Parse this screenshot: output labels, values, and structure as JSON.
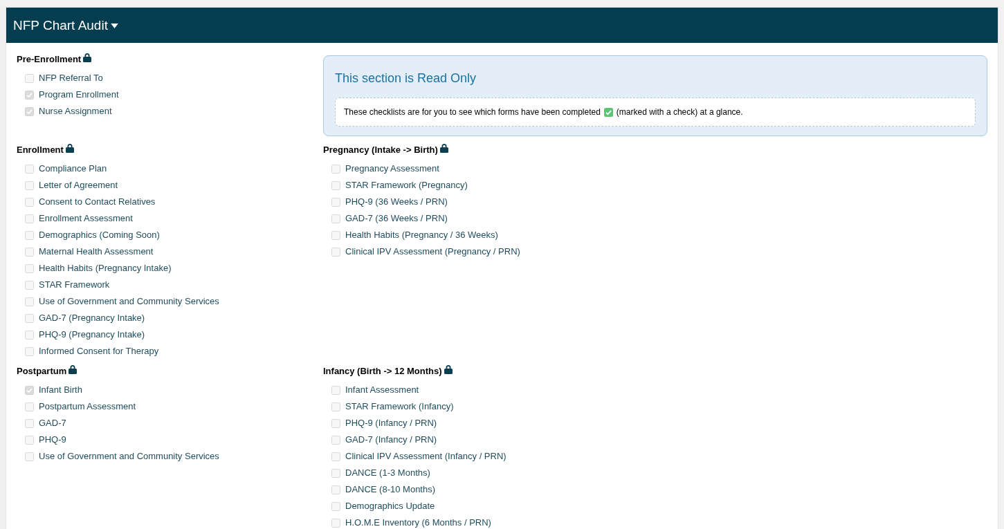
{
  "header": {
    "title": "NFP Chart Audit"
  },
  "notice": {
    "title": "This section is Read Only",
    "text_before": "These checklists are for you to see which forms have been completed",
    "text_after": "(marked with a check) at a glance."
  },
  "sections": [
    {
      "title": "Pre-Enrollment",
      "locked": true,
      "items": [
        {
          "label": "NFP Referral To",
          "checked": false
        },
        {
          "label": "Program Enrollment",
          "checked": true
        },
        {
          "label": "Nurse Assignment",
          "checked": true
        }
      ]
    },
    {
      "title": "Enrollment",
      "locked": true,
      "items": [
        {
          "label": "Compliance Plan",
          "checked": false
        },
        {
          "label": "Letter of Agreement",
          "checked": false
        },
        {
          "label": "Consent to Contact Relatives",
          "checked": false
        },
        {
          "label": "Enrollment Assessment",
          "checked": false
        },
        {
          "label": "Demographics (Coming Soon)",
          "checked": false
        },
        {
          "label": "Maternal Health Assessment",
          "checked": false
        },
        {
          "label": "Health Habits (Pregnancy Intake)",
          "checked": false
        },
        {
          "label": "STAR Framework",
          "checked": false
        },
        {
          "label": "Use of Government and Community Services",
          "checked": false
        },
        {
          "label": "GAD-7 (Pregnancy Intake)",
          "checked": false
        },
        {
          "label": "PHQ-9 (Pregnancy Intake)",
          "checked": false
        },
        {
          "label": "Informed Consent for Therapy",
          "checked": false
        }
      ]
    },
    {
      "title": "Pregnancy (Intake -> Birth)",
      "locked": true,
      "items": [
        {
          "label": "Pregnancy Assessment",
          "checked": false
        },
        {
          "label": "STAR Framework (Pregnancy)",
          "checked": false
        },
        {
          "label": "PHQ-9 (36 Weeks / PRN)",
          "checked": false
        },
        {
          "label": "GAD-7 (36 Weeks / PRN)",
          "checked": false
        },
        {
          "label": "Health Habits (Pregnancy / 36 Weeks)",
          "checked": false
        },
        {
          "label": "Clinical IPV Assessment (Pregnancy / PRN)",
          "checked": false
        }
      ]
    },
    {
      "title": "Postpartum",
      "locked": true,
      "items": [
        {
          "label": "Infant Birth",
          "checked": true
        },
        {
          "label": "Postpartum Assessment",
          "checked": false
        },
        {
          "label": "GAD-7",
          "checked": false
        },
        {
          "label": "PHQ-9",
          "checked": false
        },
        {
          "label": "Use of Government and Community Services",
          "checked": false
        }
      ]
    },
    {
      "title": "Infancy (Birth -> 12 Months)",
      "locked": true,
      "items": [
        {
          "label": "Infant Assessment",
          "checked": false
        },
        {
          "label": "STAR Framework (Infancy)",
          "checked": false
        },
        {
          "label": "PHQ-9 (Infancy / PRN)",
          "checked": false
        },
        {
          "label": "GAD-7 (Infancy / PRN)",
          "checked": false
        },
        {
          "label": "Clinical IPV Assessment (Infancy / PRN)",
          "checked": false
        },
        {
          "label": "DANCE (1-3 Months)",
          "checked": false
        },
        {
          "label": "DANCE (8-10 Months)",
          "checked": false
        },
        {
          "label": "Demographics Update",
          "checked": false
        },
        {
          "label": "H.O.M.E Inventory (6 Months / PRN)",
          "checked": false
        }
      ]
    }
  ]
}
